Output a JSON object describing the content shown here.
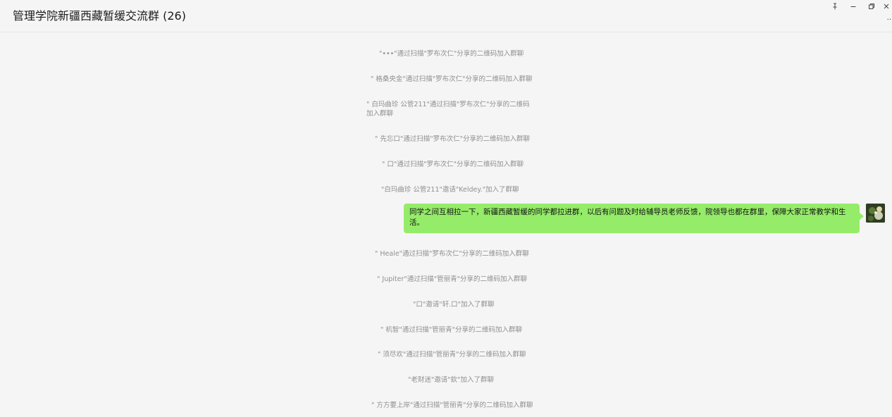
{
  "window": {
    "title": "管理学院新疆西藏暂缓交流群 (26)",
    "more_label": ".."
  },
  "colors": {
    "background": "#f5f5f5",
    "bubble_self": "#95ec69",
    "system_text": "#8f8f8f"
  },
  "icons": {
    "pin": "pin-icon",
    "minimize": "minimize-icon",
    "restore": "restore-icon",
    "close": "close-icon"
  },
  "messages": {
    "system": [
      "\"•••\"通过扫描\"罗布次仁\"分享的二维码加入群聊",
      "\" 格桑央金\"通过扫描\"罗布次仁\"分享的二维码加入群聊",
      "\" 白玛曲珍 公管211\"通过扫描\"罗布次仁\"分享的二维码加入群聊",
      "\" 先忘口\"通过扫描\"罗布次仁\"分享的二维码加入群聊",
      "\" 口\"通过扫描\"罗布次仁\"分享的二维码加入群聊",
      "\"白玛曲珍 公管211\"邀请\"Keldey.\"加入了群聊",
      "\" Heale\"通过扫描\"罗布次仁\"分享的二维码加入群聊",
      "\" Jupiter\"通过扫描\"管丽青\"分享的二维码加入群聊",
      "\"口\"邀请\"轩.口\"加入了群聊",
      "\" 机智\"通过扫描\"管丽青\"分享的二维码加入群聊",
      "\" 须尽欢\"通过扫描\"管丽青\"分享的二维码加入群聊",
      "\"老财迷\"邀请\"欽\"加入了群聊",
      "\" 方方要上岸\"通过扫描\"管丽青\"分享的二维码加入群聊"
    ],
    "self_message": "同学之间互相拉一下，新疆西藏暂缓的同学都拉进群，以后有问题及时给辅导员老师反馈，院领导也都在群里，保障大家正常教学和生活。"
  }
}
